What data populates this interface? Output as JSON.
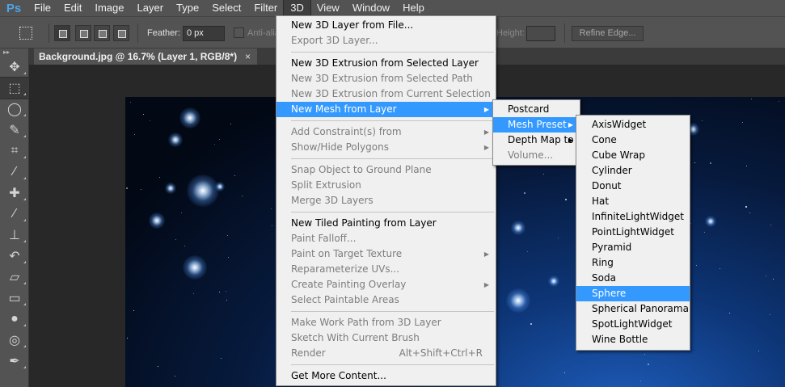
{
  "app": {
    "logo": "Ps"
  },
  "menubar": {
    "items": [
      "File",
      "Edit",
      "Image",
      "Layer",
      "Type",
      "Select",
      "Filter",
      "3D",
      "View",
      "Window",
      "Help"
    ],
    "active": "3D"
  },
  "options": {
    "feather_label": "Feather:",
    "feather_value": "0 px",
    "antialias_label": "Anti-alias",
    "height_label": "Height:",
    "refine_label": "Refine Edge..."
  },
  "document": {
    "tab_title": "Background.jpg @ 16.7% (Layer 1, RGB/8*)",
    "close_glyph": "×"
  },
  "tools": [
    "move-icon",
    "marquee-icon",
    "lasso-icon",
    "quick-select-icon",
    "crop-icon",
    "eyedropper-icon",
    "healing-icon",
    "brush-icon",
    "stamp-icon",
    "history-brush-icon",
    "eraser-icon",
    "gradient-icon",
    "blur-icon",
    "dodge-icon",
    "pen-icon"
  ],
  "menu3d": {
    "groups": [
      [
        {
          "label": "New 3D Layer from File...",
          "enabled": true
        },
        {
          "label": "Export 3D Layer...",
          "enabled": false
        }
      ],
      [
        {
          "label": "New 3D Extrusion from Selected Layer",
          "enabled": true
        },
        {
          "label": "New 3D Extrusion from Selected Path",
          "enabled": false
        },
        {
          "label": "New 3D Extrusion from Current Selection",
          "enabled": false
        },
        {
          "label": "New Mesh from Layer",
          "enabled": true,
          "submenu": true,
          "highlighted": true
        }
      ],
      [
        {
          "label": "Add Constraint(s) from",
          "enabled": false,
          "submenu": true
        },
        {
          "label": "Show/Hide Polygons",
          "enabled": false,
          "submenu": true
        }
      ],
      [
        {
          "label": "Snap Object to Ground Plane",
          "enabled": false
        },
        {
          "label": "Split Extrusion",
          "enabled": false
        },
        {
          "label": "Merge 3D Layers",
          "enabled": false
        }
      ],
      [
        {
          "label": "New Tiled Painting from Layer",
          "enabled": true
        },
        {
          "label": "Paint Falloff...",
          "enabled": false
        },
        {
          "label": "Paint on Target Texture",
          "enabled": false,
          "submenu": true
        },
        {
          "label": "Reparameterize UVs...",
          "enabled": false
        },
        {
          "label": "Create Painting Overlay",
          "enabled": false,
          "submenu": true
        },
        {
          "label": "Select Paintable Areas",
          "enabled": false
        }
      ],
      [
        {
          "label": "Make Work Path from 3D Layer",
          "enabled": false
        },
        {
          "label": "Sketch With Current Brush",
          "enabled": false
        },
        {
          "label": "Render",
          "enabled": false,
          "shortcut": "Alt+Shift+Ctrl+R"
        }
      ],
      [
        {
          "label": "Get More Content...",
          "enabled": true
        }
      ]
    ]
  },
  "newmesh_menu": [
    {
      "label": "Postcard",
      "enabled": true
    },
    {
      "label": "Mesh Preset",
      "enabled": true,
      "submenu": true,
      "highlighted": true
    },
    {
      "label": "Depth Map to",
      "enabled": true,
      "submenu": true
    },
    {
      "label": "Volume...",
      "enabled": false
    }
  ],
  "preset_menu": [
    {
      "label": "AxisWidget"
    },
    {
      "label": "Cone"
    },
    {
      "label": "Cube Wrap"
    },
    {
      "label": "Cylinder"
    },
    {
      "label": "Donut"
    },
    {
      "label": "Hat"
    },
    {
      "label": "InfiniteLightWidget"
    },
    {
      "label": "PointLightWidget"
    },
    {
      "label": "Pyramid"
    },
    {
      "label": "Ring"
    },
    {
      "label": "Soda"
    },
    {
      "label": "Sphere",
      "highlighted": true
    },
    {
      "label": "Spherical Panorama"
    },
    {
      "label": "SpotLightWidget"
    },
    {
      "label": "Wine Bottle"
    }
  ],
  "colors": {
    "menu_highlight": "#3399ff",
    "ui_bg": "#535353",
    "canvas_dark": "#020814",
    "canvas_blue": "#1f5fbf"
  }
}
